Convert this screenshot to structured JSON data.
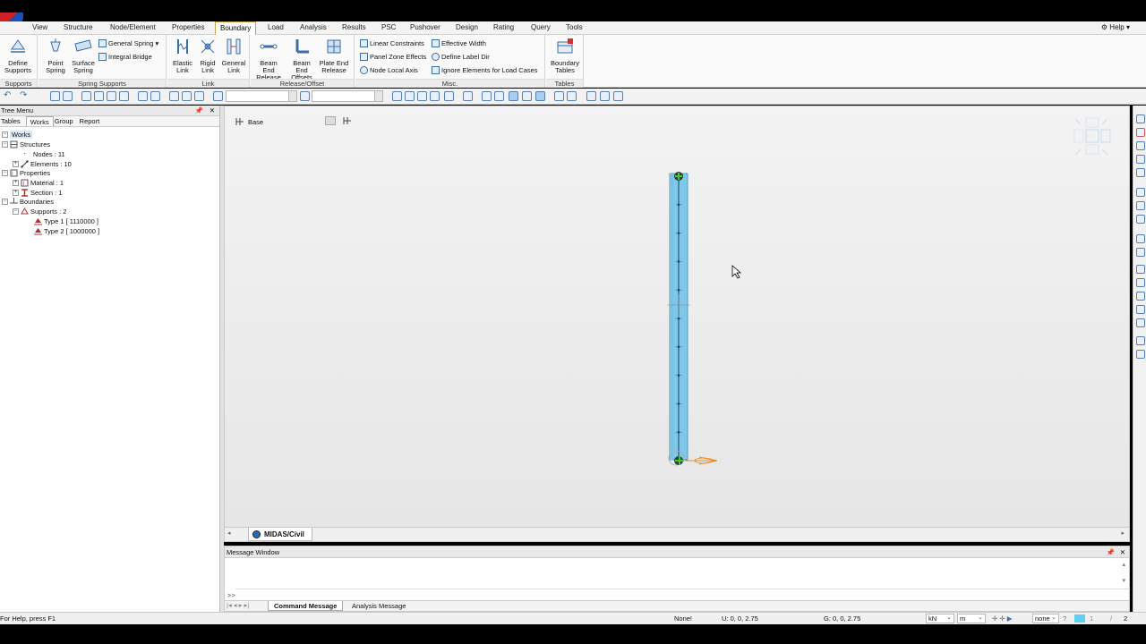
{
  "menu": {
    "tabs": [
      "View",
      "Structure",
      "Node/Element",
      "Properties",
      "Boundary",
      "Load",
      "Analysis",
      "Results",
      "PSC",
      "Pushover",
      "Design",
      "Rating",
      "Query",
      "Tools"
    ],
    "active": "Boundary",
    "help": "Help"
  },
  "ribbon": {
    "supports": {
      "label": "Supports",
      "define": "Define\nSupports"
    },
    "spring": {
      "label": "Spring Supports",
      "point": "Point\nSpring",
      "surface": "Surface\nSpring",
      "general": "General Spring",
      "integral": "Integral Bridge"
    },
    "link": {
      "label": "Link",
      "elastic": "Elastic\nLink",
      "rigid": "Rigid\nLink",
      "general": "General\nLink"
    },
    "release": {
      "label": "Release/Offset",
      "beam_end": "Beam End\nRelease",
      "beam_offsets": "Beam End\nOffsets",
      "plate_end": "Plate End\nRelease"
    },
    "misc": {
      "label": "Misc.",
      "linear": "Linear Constraints",
      "panel": "Panel Zone Effects",
      "node_local": "Node Local Axis",
      "effective": "Effective Width",
      "define_label": "Define Label Dir",
      "ignore": "Ignore Elements for Load Cases"
    },
    "tables": {
      "label": "Tables",
      "boundary": "Boundary\nTables"
    }
  },
  "tree": {
    "title": "Tree Menu",
    "tabs": [
      "Tables",
      "Works",
      "Group",
      "Report"
    ],
    "active_tab": "Works",
    "nodes": {
      "works": "Works",
      "structures": "Structures",
      "nodes": "Nodes : 11",
      "elements": "Elements : 10",
      "properties": "Properties",
      "material": "Material : 1",
      "section": "Section : 1",
      "boundaries": "Boundaries",
      "supports": "Supports : 2",
      "type1": "Type 1 [ 1110000 ]",
      "type2": "Type 2 [ 1000000 ]"
    }
  },
  "viewport": {
    "view_name": "Base",
    "doc_tab": "MIDAS/Civil",
    "nodes": 11,
    "accent": "#7ec8e8"
  },
  "messages": {
    "title": "Message Window",
    "prompt": ">>",
    "tabs": [
      "Command Message",
      "Analysis Message"
    ],
    "active_tab": "Command Message"
  },
  "status": {
    "help": "For Help, press F1",
    "selection": "None!",
    "u_coord": "U: 0, 0, 2.75",
    "g_coord": "G: 0, 0, 2.75",
    "force_unit": "kN",
    "length_unit": "m",
    "filter": "none",
    "page": "1",
    "page_total": "2"
  }
}
